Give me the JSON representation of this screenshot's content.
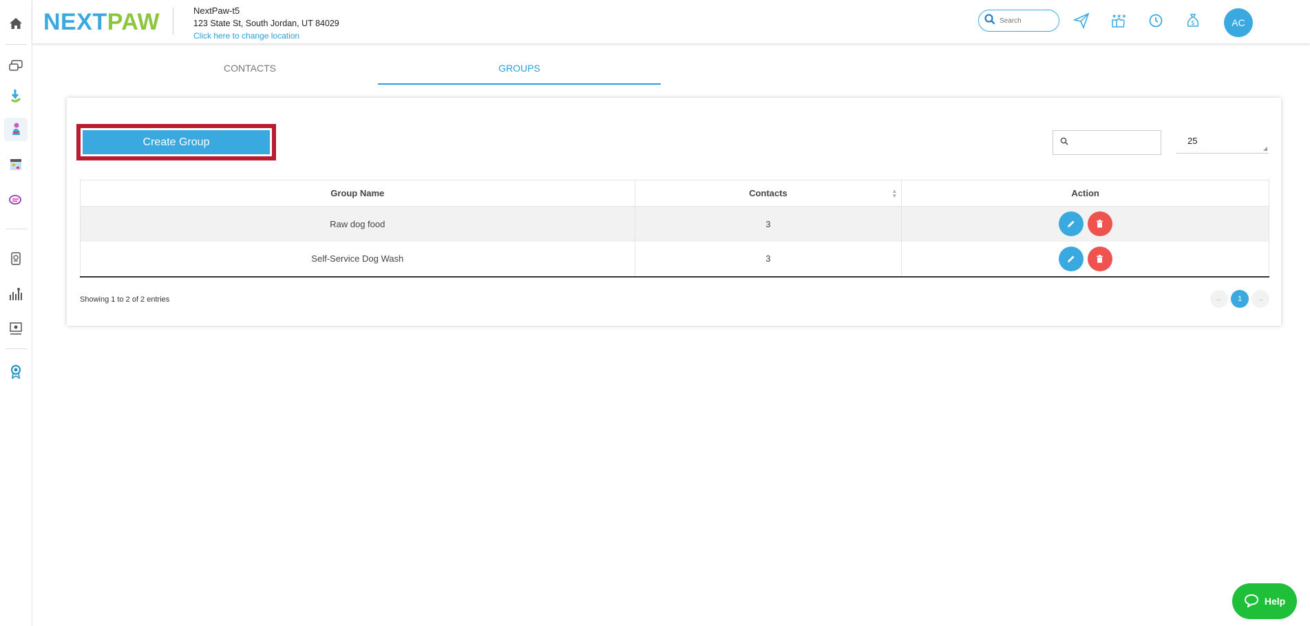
{
  "header": {
    "logo_next": "NEXT",
    "logo_paw": "PAW",
    "location_name": "NextPaw-t5",
    "location_address": "123 State St, South Jordan, UT 84029",
    "change_location": "Click here to change location",
    "search_placeholder": "Search",
    "avatar_initials": "AC"
  },
  "tabs": [
    {
      "label": "CONTACTS"
    },
    {
      "label": "GROUPS"
    }
  ],
  "toolbar": {
    "create_label": "Create Group",
    "page_size": "25"
  },
  "table": {
    "columns": [
      "Group Name",
      "Contacts",
      "Action"
    ],
    "rows": [
      {
        "name": "Raw dog food",
        "contacts": "3"
      },
      {
        "name": "Self-Service Dog Wash",
        "contacts": "3"
      }
    ]
  },
  "footer": {
    "showing": "Showing 1 to 2 of 2 entries",
    "current_page": "1",
    "prev": "←",
    "next": "→"
  },
  "help_label": "Help",
  "colors": {
    "accent": "#3aa9e0",
    "brand_green": "#8cc63f",
    "danger": "#ef5350",
    "highlight": "#b81c2e",
    "help": "#1fbf3a"
  }
}
